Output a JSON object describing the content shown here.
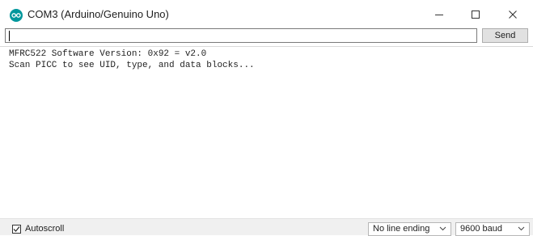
{
  "window": {
    "title": "COM3 (Arduino/Genuino Uno)",
    "icon": "arduino-logo-icon",
    "accent_color": "#00979c"
  },
  "send_bar": {
    "input_value": "",
    "send_label": "Send"
  },
  "serial_output": {
    "lines": [
      "MFRC522 Software Version: 0x92 = v2.0",
      "Scan PICC to see UID, type, and data blocks..."
    ]
  },
  "status_bar": {
    "autoscroll_label": "Autoscroll",
    "autoscroll_checked": true,
    "line_ending": "No line ending",
    "baud_rate": "9600 baud"
  }
}
